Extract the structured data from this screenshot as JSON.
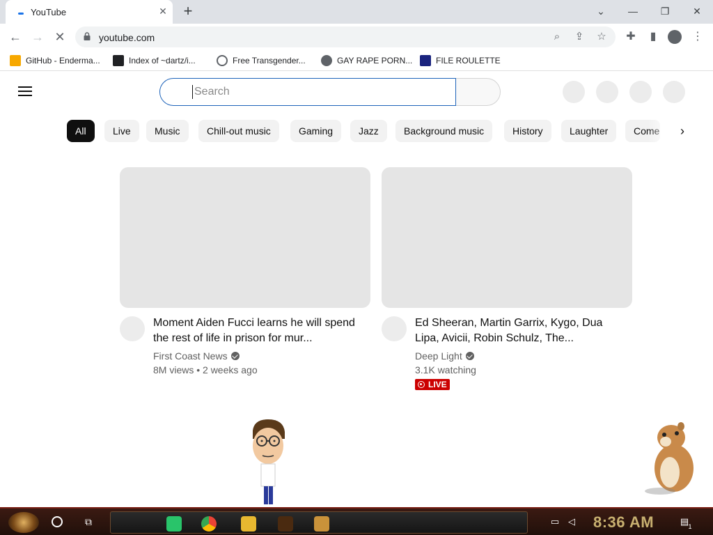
{
  "browser": {
    "tab_title": "YouTube",
    "url": "youtube.com",
    "bookmarks": [
      {
        "label": "GitHub - Enderma...",
        "icon": "ph-badge-icon",
        "color": "#f7a800"
      },
      {
        "label": "Index of ~dartz/i...",
        "icon": "qr-icon",
        "color": "#202124"
      },
      {
        "label": "Free Transgender...",
        "icon": "mask-icon",
        "color": "#5f6368"
      },
      {
        "label": "GAY RAPE PORN...",
        "icon": "globe-icon",
        "color": "#5f6368"
      },
      {
        "label": "FILE ROULETTE",
        "icon": "mf-icon",
        "color": "#1a237e"
      }
    ]
  },
  "youtube": {
    "search_placeholder": "Search",
    "chips": [
      "All",
      "Live",
      "Music",
      "Chill-out music",
      "Gaming",
      "Jazz",
      "Background music",
      "History",
      "Laughter",
      "Comedy"
    ],
    "videos": [
      {
        "title": "Moment Aiden Fucci learns he will spend the rest of life in prison for mur...",
        "channel": "First Coast News",
        "stats": "8M views • 2 weeks ago",
        "live": false
      },
      {
        "title": "Ed Sheeran, Martin Garrix, Kygo, Dua Lipa, Avicii, Robin Schulz, The...",
        "channel": "Deep Light",
        "stats": "3.1K watching",
        "live": true,
        "live_label": "LIVE"
      }
    ]
  },
  "taskbar": {
    "clock": "8:36 AM",
    "notification_count": "1"
  },
  "colors": {
    "accent": "#1c62b9",
    "live_red": "#cc0000",
    "taskbar": "#2a140c"
  }
}
